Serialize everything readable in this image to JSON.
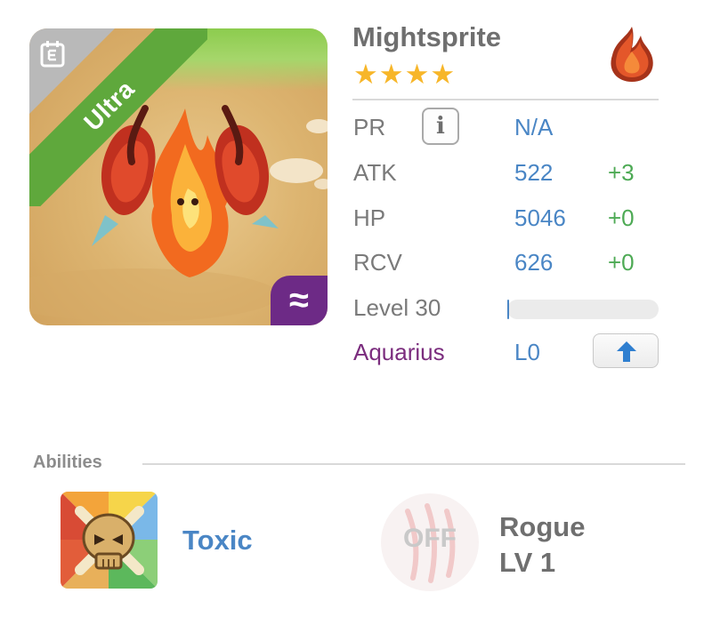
{
  "card": {
    "rarity": "Ultra",
    "element_tab_symbol": "≈",
    "element_tab_icon": "aquarius-waves-icon",
    "card_icon": "card-icon",
    "creature_icon": "fire-sprite-creature"
  },
  "header": {
    "name": "Mightsprite",
    "stars": "★★★★",
    "star_count": 4,
    "element_icon": "fire-icon"
  },
  "stats": {
    "pr": {
      "label": "PR",
      "value": "N/A",
      "info_label": "i"
    },
    "atk": {
      "label": "ATK",
      "value": "522",
      "bonus": "+3"
    },
    "hp": {
      "label": "HP",
      "value": "5046",
      "bonus": "+0"
    },
    "rcv": {
      "label": "RCV",
      "value": "626",
      "bonus": "+0"
    },
    "level": {
      "label": "Level 30",
      "progress": 0.01
    },
    "zodiac": {
      "label": "Aquarius",
      "value": "L0",
      "button_icon": "arrow-up-icon"
    }
  },
  "abilities": {
    "title": "Abilities",
    "active": {
      "name": "Toxic",
      "icon": "toxic-skull-icon"
    },
    "rogue": {
      "status": "OFF",
      "name": "Rogue",
      "level": "LV 1",
      "icon": "claw-icon"
    }
  },
  "colors": {
    "accent_blue": "#4a86c5",
    "bonus_green": "#4eaa55",
    "zodiac_purple": "#7b2d7e",
    "ribbon_green": "#5fa83c",
    "star_gold": "#f7b629"
  }
}
